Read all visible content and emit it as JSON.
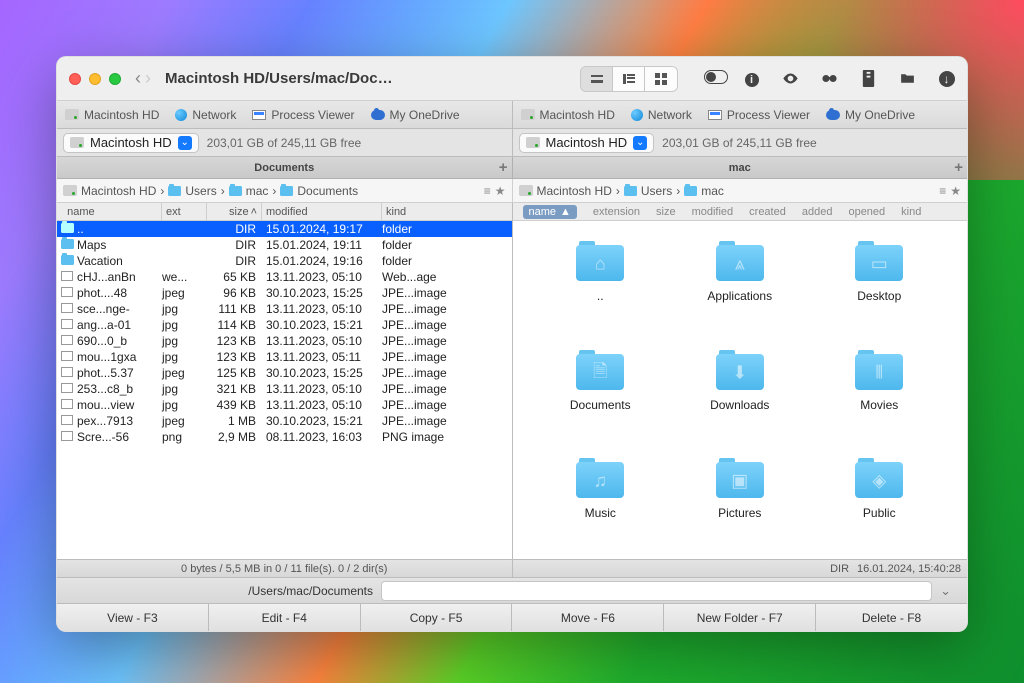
{
  "window": {
    "title": "Macintosh HD/Users/mac/Docu...",
    "path_label": "/Users/mac/Documents",
    "fkeys": [
      "View - F3",
      "Edit - F4",
      "Copy - F5",
      "Move - F6",
      "New Folder - F7",
      "Delete - F8"
    ]
  },
  "tabs": {
    "left": [
      {
        "icon": "drive",
        "label": "Macintosh HD"
      },
      {
        "icon": "globe",
        "label": "Network"
      },
      {
        "icon": "pv",
        "label": "Process Viewer"
      },
      {
        "icon": "cloud",
        "label": "My OneDrive"
      }
    ],
    "right": [
      {
        "icon": "drive",
        "label": "Macintosh HD"
      },
      {
        "icon": "globe",
        "label": "Network"
      },
      {
        "icon": "pv",
        "label": "Process Viewer"
      },
      {
        "icon": "cloud",
        "label": "My OneDrive"
      }
    ]
  },
  "drive": {
    "name": "Macintosh HD",
    "free": "203,01 GB of 245,11 GB free"
  },
  "panel_titles": {
    "left": "Documents",
    "right": "mac"
  },
  "crumbs": {
    "left": [
      "Macintosh HD",
      "Users",
      "mac",
      "Documents"
    ],
    "right": [
      "Macintosh HD",
      "Users",
      "mac"
    ]
  },
  "list_headers": {
    "name": "name",
    "ext": "ext",
    "size": "size",
    "mod": "modified",
    "kind": "kind"
  },
  "icon_headers": [
    "name",
    "extension",
    "size",
    "modified",
    "created",
    "added",
    "opened",
    "kind"
  ],
  "files": [
    {
      "ic": "folder",
      "name": "..",
      "ext": "",
      "size": "DIR",
      "mod": "15.01.2024, 19:17",
      "kind": "folder",
      "sel": true
    },
    {
      "ic": "folder",
      "name": "Maps",
      "ext": "",
      "size": "DIR",
      "mod": "15.01.2024, 19:11",
      "kind": "folder"
    },
    {
      "ic": "folder",
      "name": "Vacation",
      "ext": "",
      "size": "DIR",
      "mod": "15.01.2024, 19:16",
      "kind": "folder"
    },
    {
      "ic": "web",
      "name": "cHJ...anBn",
      "ext": "we...",
      "size": "65 KB",
      "mod": "13.11.2023, 05:10",
      "kind": "Web...age"
    },
    {
      "ic": "img",
      "name": "phot....48",
      "ext": "jpeg",
      "size": "96 KB",
      "mod": "30.10.2023, 15:25",
      "kind": "JPE...image"
    },
    {
      "ic": "img",
      "name": "sce...nge-",
      "ext": "jpg",
      "size": "111 KB",
      "mod": "13.11.2023, 05:10",
      "kind": "JPE...image"
    },
    {
      "ic": "img",
      "name": "ang...a-01",
      "ext": "jpg",
      "size": "114 KB",
      "mod": "30.10.2023, 15:21",
      "kind": "JPE...image"
    },
    {
      "ic": "img",
      "name": "690...0_b",
      "ext": "jpg",
      "size": "123 KB",
      "mod": "13.11.2023, 05:10",
      "kind": "JPE...image"
    },
    {
      "ic": "img",
      "name": "mou...1gxa",
      "ext": "jpg",
      "size": "123 KB",
      "mod": "13.11.2023, 05:11",
      "kind": "JPE...image"
    },
    {
      "ic": "img",
      "name": "phot...5.37",
      "ext": "jpeg",
      "size": "125 KB",
      "mod": "30.10.2023, 15:25",
      "kind": "JPE...image"
    },
    {
      "ic": "img",
      "name": "253...c8_b",
      "ext": "jpg",
      "size": "321 KB",
      "mod": "13.11.2023, 05:10",
      "kind": "JPE...image"
    },
    {
      "ic": "img",
      "name": "mou...view",
      "ext": "jpg",
      "size": "439 KB",
      "mod": "13.11.2023, 05:10",
      "kind": "JPE...image"
    },
    {
      "ic": "img",
      "name": "pex...7913",
      "ext": "jpeg",
      "size": "1 MB",
      "mod": "30.10.2023, 15:21",
      "kind": "JPE...image"
    },
    {
      "ic": "img",
      "name": "Scre...-56",
      "ext": "png",
      "size": "2,9 MB",
      "mod": "08.11.2023, 16:03",
      "kind": "PNG image"
    }
  ],
  "icons_panel": [
    {
      "name": "..",
      "glyph": "home"
    },
    {
      "name": "Applications",
      "glyph": "app"
    },
    {
      "name": "Desktop",
      "glyph": "desktop"
    },
    {
      "name": "Documents",
      "glyph": "doc"
    },
    {
      "name": "Downloads",
      "glyph": "down"
    },
    {
      "name": "Movies",
      "glyph": "movie"
    },
    {
      "name": "Music",
      "glyph": "music"
    },
    {
      "name": "Pictures",
      "glyph": "picture"
    },
    {
      "name": "Public",
      "glyph": "public"
    }
  ],
  "status": {
    "left": "0 bytes / 5,5 MB in 0 / 11 file(s). 0 / 2 dir(s)",
    "right_type": "DIR",
    "right_time": "16.01.2024, 15:40:28"
  },
  "glyphs": {
    "home": "⌂",
    "app": "⩓",
    "desktop": "▭",
    "doc": "🗎",
    "down": "⬇",
    "movie": "⦀",
    "music": "♫",
    "picture": "▣",
    "public": "◈"
  }
}
